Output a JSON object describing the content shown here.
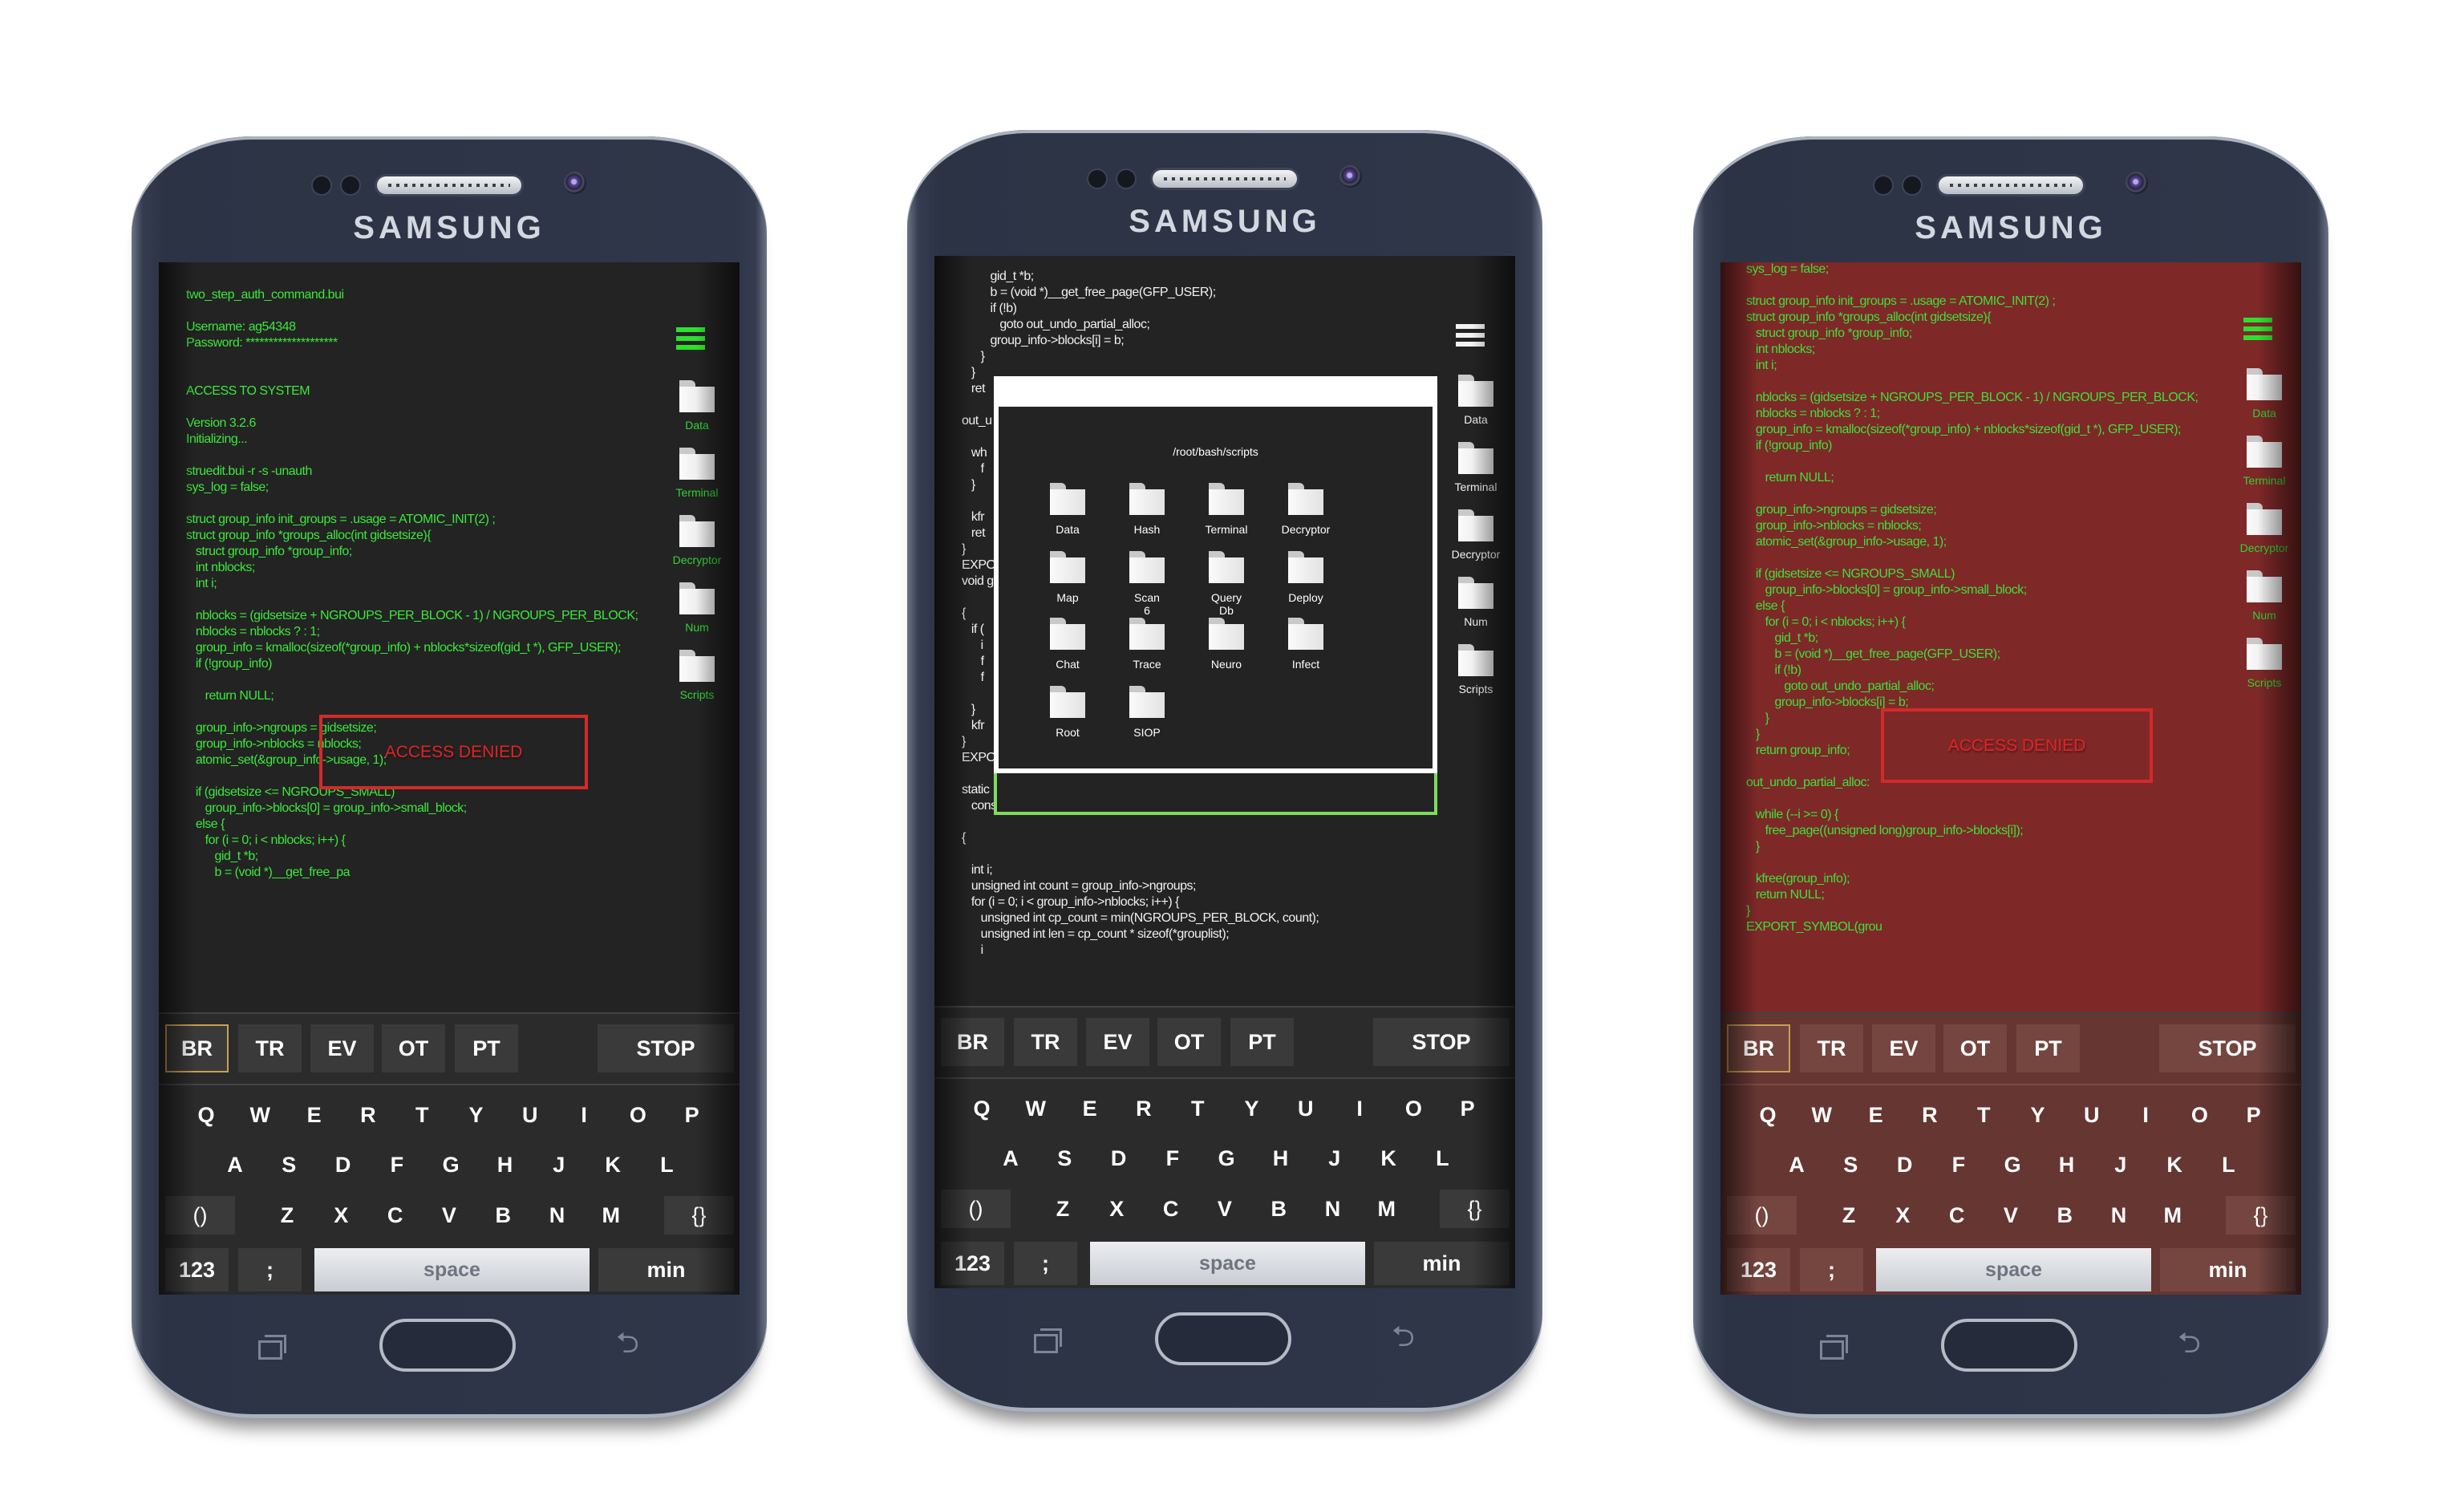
{
  "brand": "SAMSUNG",
  "colors": {
    "code_green": "#3be83b",
    "code_white": "#f0f0f0",
    "screen_dark": "#232323",
    "screen_red": "#7e2828",
    "keyboard_dark": "#2b2b2b",
    "keyboard_red": "#663632",
    "key_dark": "#3a3a3a",
    "key_red": "#754540",
    "denied_red": "#d42a2a",
    "selected_border": "#c8a050",
    "dialog_accent": "#7fdc5c"
  },
  "sidebar": {
    "menu_icon": "hamburger-menu-icon",
    "items": [
      "Data",
      "Terminal",
      "Decryptor",
      "Num",
      "Scripts"
    ]
  },
  "keyboard": {
    "function_keys": [
      "BR",
      "TR",
      "EV",
      "OT",
      "PT"
    ],
    "stop": "STOP",
    "row1": [
      "Q",
      "W",
      "E",
      "R",
      "T",
      "Y",
      "U",
      "I",
      "O",
      "P"
    ],
    "row2": [
      "A",
      "S",
      "D",
      "F",
      "G",
      "H",
      "J",
      "K",
      "L"
    ],
    "row3": [
      "Z",
      "X",
      "C",
      "V",
      "B",
      "N",
      "M"
    ],
    "left_special": "()",
    "right_special": "{}",
    "numbers": "123",
    "semicolon": ";",
    "space": "space",
    "min": "min"
  },
  "phones": [
    {
      "theme": "dark",
      "selected_function_key": "BR",
      "access_denied": "ACCESS DENIED",
      "code_lines": [
        "two_step_auth_command.bui",
        "",
        "Username: ag54348",
        "Password: ********************",
        "",
        "",
        "ACCESS TO SYSTEM",
        "",
        "Version 3.2.6",
        "Initializing...",
        "",
        "struedit.bui -r -s -unauth",
        "sys_log = false;",
        "",
        "struct group_info init_groups = .usage = ATOMIC_INIT(2) ;",
        "struct group_info *groups_alloc(int gidsetsize){",
        "   struct group_info *group_info;",
        "   int nblocks;",
        "   int i;",
        "",
        "   nblocks = (gidsetsize + NGROUPS_PER_BLOCK - 1) / NGROUPS_PER_BLOCK;",
        "   nblocks = nblocks ? : 1;",
        "   group_info = kmalloc(sizeof(*group_info) + nblocks*sizeof(gid_t *), GFP_USER);",
        "   if (!group_info)",
        "",
        "      return NULL;",
        "",
        "   group_info->ngroups = gidsetsize;",
        "   group_info->nblocks = nblocks;",
        "   atomic_set(&group_info->usage, 1);",
        "",
        "   if (gidsetsize <= NGROUPS_SMALL)",
        "      group_info->blocks[0] = group_info->small_block;",
        "   else {",
        "      for (i = 0; i < nblocks; i++) {",
        "         gid_t *b;",
        "         b = (void *)__get_free_pa"
      ]
    },
    {
      "theme": "dialog",
      "selected_function_key": "",
      "dialog": {
        "path": "/root/bash/scripts",
        "folders": [
          "Data",
          "Hash",
          "Terminal",
          "Decryptor",
          "Map",
          "Scan 6",
          "Query Db",
          "Deploy",
          "Chat",
          "Trace",
          "Neuro",
          "Infect",
          "Root",
          "SIOP"
        ]
      },
      "code_lines": [
        "         gid_t *b;",
        "         b = (void *)__get_free_page(GFP_USER);",
        "         if (!b)",
        "            goto out_undo_partial_alloc;",
        "         group_info->blocks[i] = b;",
        "      }",
        "   }",
        "   ret",
        "",
        "out_u",
        "",
        "   wh",
        "      f",
        "   }",
        "",
        "   kfr",
        "   ret",
        "}",
        "EXPO",
        "void g",
        "",
        "{",
        "   if (",
        "      i",
        "      f",
        "      f",
        "",
        "   }",
        "   kfr",
        "}",
        "EXPO",
        "",
        "static",
        "   const struct group_info *group_info)",
        "",
        "{",
        "",
        "   int i;",
        "   unsigned int count = group_info->ngroups;",
        "   for (i = 0; i < group_info->nblocks; i++) {",
        "      unsigned int cp_count = min(NGROUPS_PER_BLOCK, count);",
        "      unsigned int len = cp_count * sizeof(*grouplist);",
        "      i"
      ]
    },
    {
      "theme": "red",
      "selected_function_key": "BR",
      "access_denied": "ACCESS DENIED",
      "code_lines": [
        "sys_log = false;",
        "",
        "struct group_info init_groups = .usage = ATOMIC_INIT(2) ;",
        "struct group_info *groups_alloc(int gidsetsize){",
        "   struct group_info *group_info;",
        "   int nblocks;",
        "   int i;",
        "",
        "   nblocks = (gidsetsize + NGROUPS_PER_BLOCK - 1) / NGROUPS_PER_BLOCK;",
        "   nblocks = nblocks ? : 1;",
        "   group_info = kmalloc(sizeof(*group_info) + nblocks*sizeof(gid_t *), GFP_USER);",
        "   if (!group_info)",
        "",
        "      return NULL;",
        "",
        "   group_info->ngroups = gidsetsize;",
        "   group_info->nblocks = nblocks;",
        "   atomic_set(&group_info->usage, 1);",
        "",
        "   if (gidsetsize <= NGROUPS_SMALL)",
        "      group_info->blocks[0] = group_info->small_block;",
        "   else {",
        "      for (i = 0; i < nblocks; i++) {",
        "         gid_t *b;",
        "         b = (void *)__get_free_page(GFP_USER);",
        "         if (!b)",
        "            goto out_undo_partial_alloc;",
        "         group_info->blocks[i] = b;",
        "      }",
        "   }",
        "   return group_info;",
        "",
        "out_undo_partial_alloc:",
        "",
        "   while (--i >= 0) {",
        "      free_page((unsigned long)group_info->blocks[i]);",
        "   }",
        "",
        "   kfree(group_info);",
        "   return NULL;",
        "}",
        "EXPORT_SYMBOL(grou"
      ]
    }
  ]
}
